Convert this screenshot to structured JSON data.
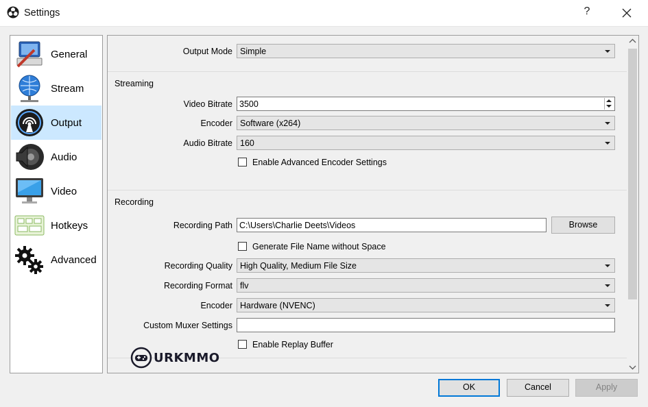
{
  "window": {
    "title": "Settings",
    "help": "?"
  },
  "sidebar": {
    "items": [
      {
        "label": "General",
        "icon": "general-icon"
      },
      {
        "label": "Stream",
        "icon": "stream-icon"
      },
      {
        "label": "Output",
        "icon": "output-icon",
        "selected": true
      },
      {
        "label": "Audio",
        "icon": "audio-icon"
      },
      {
        "label": "Video",
        "icon": "video-icon"
      },
      {
        "label": "Hotkeys",
        "icon": "hotkeys-icon"
      },
      {
        "label": "Advanced",
        "icon": "advanced-icon"
      }
    ]
  },
  "output_mode": {
    "label": "Output Mode",
    "value": "Simple"
  },
  "streaming": {
    "title": "Streaming",
    "video_bitrate": {
      "label": "Video Bitrate",
      "value": "3500"
    },
    "encoder": {
      "label": "Encoder",
      "value": "Software (x264)"
    },
    "audio_bitrate": {
      "label": "Audio Bitrate",
      "value": "160"
    },
    "advanced_encoder": {
      "label": "Enable Advanced Encoder Settings",
      "checked": false
    }
  },
  "recording": {
    "title": "Recording",
    "path": {
      "label": "Recording Path",
      "value": "C:\\Users\\Charlie Deets\\Videos",
      "browse": "Browse"
    },
    "no_space": {
      "label": "Generate File Name without Space",
      "checked": false
    },
    "quality": {
      "label": "Recording Quality",
      "value": "High Quality, Medium File Size"
    },
    "format": {
      "label": "Recording Format",
      "value": "flv"
    },
    "encoder": {
      "label": "Encoder",
      "value": "Hardware (NVENC)"
    },
    "muxer": {
      "label": "Custom Muxer Settings",
      "value": ""
    },
    "replay": {
      "label": "Enable Replay Buffer",
      "checked": false
    }
  },
  "footer": {
    "ok": "OK",
    "cancel": "Cancel",
    "apply": "Apply"
  },
  "watermark": {
    "text": "URKMMO"
  },
  "colors": {
    "selected_bg": "#cce8ff",
    "accent": "#0078d7"
  }
}
